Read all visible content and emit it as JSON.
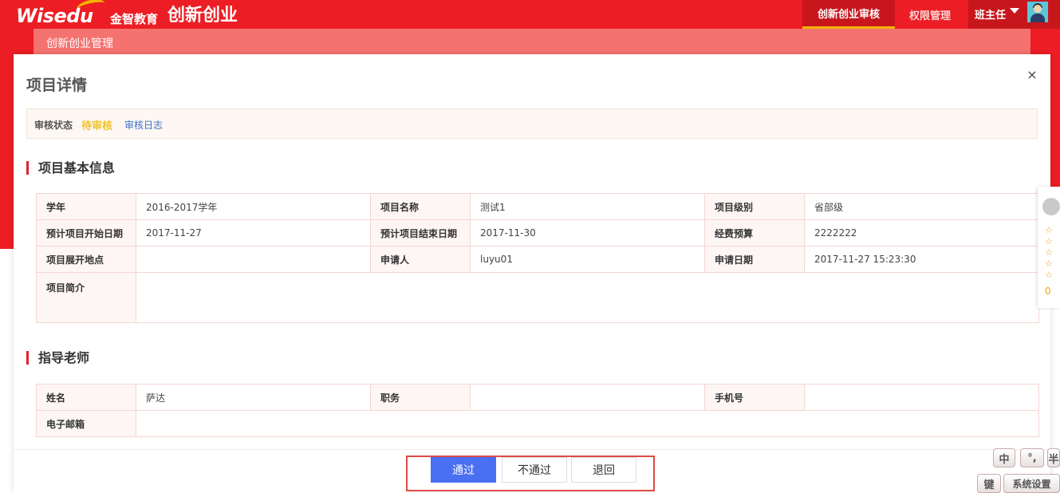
{
  "header": {
    "logo_en": "Wisedu",
    "logo_cn": "金智教育",
    "app_title": "创新创业",
    "nav": [
      {
        "label": "创新创业审核",
        "active": true
      },
      {
        "label": "权限管理",
        "active": false
      }
    ],
    "user_role": "班主任",
    "colors": {
      "header_bg": "#ec1d24",
      "active_tab_underline": "#f5b400"
    }
  },
  "subbar": {
    "title": "创新创业管理"
  },
  "dialog": {
    "title": "项目详情",
    "close_label": "×",
    "status": {
      "label": "审核状态",
      "value": "待审核",
      "log_link": "审核日志"
    },
    "basic_info": {
      "section_title": "项目基本信息",
      "rows": [
        [
          {
            "label": "学年",
            "value": "2016-2017学年"
          },
          {
            "label": "项目名称",
            "value": "测试1"
          },
          {
            "label": "项目级别",
            "value": "省部级"
          }
        ],
        [
          {
            "label": "预计项目开始日期",
            "value": "2017-11-27"
          },
          {
            "label": "预计项目结束日期",
            "value": "2017-11-30"
          },
          {
            "label": "经费预算",
            "value": "2222222"
          }
        ],
        [
          {
            "label": "项目展开地点",
            "value": ""
          },
          {
            "label": "申请人",
            "value": "luyu01"
          },
          {
            "label": "申请日期",
            "value": "2017-11-27 15:23:30"
          }
        ]
      ],
      "summary": {
        "label": "项目简介",
        "value": ""
      }
    },
    "advisor": {
      "section_title": "指导老师",
      "row": [
        {
          "label": "姓名",
          "value": "萨达"
        },
        {
          "label": "职务",
          "value": ""
        },
        {
          "label": "手机号",
          "value": ""
        }
      ],
      "email": {
        "label": "电子邮箱",
        "value": ""
      }
    },
    "actions": {
      "pass": "通过",
      "reject": "不通过",
      "back": "退回"
    }
  },
  "rating_widget": {
    "stars": [
      "☆",
      "☆",
      "☆",
      "☆",
      "☆"
    ],
    "count": "0"
  },
  "ime_toolbar": {
    "zh": "中",
    "punct": "°,",
    "half": "半",
    "keyboard": "键",
    "settings": "系统设置"
  }
}
